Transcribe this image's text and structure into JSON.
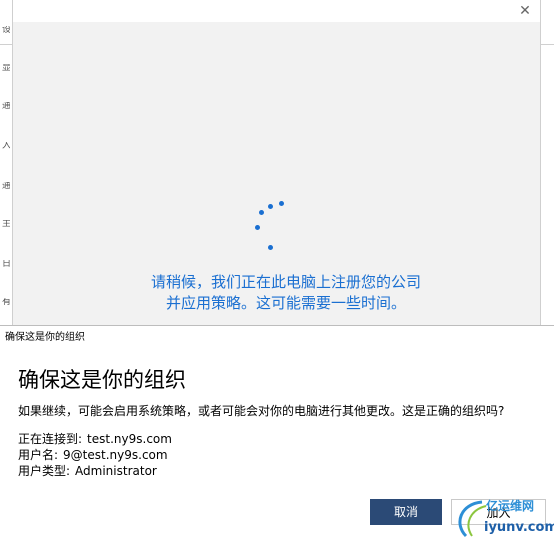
{
  "background": {
    "glyphs": [
      "设",
      "显",
      "通",
      "入",
      "通",
      "主",
      "日",
      "有"
    ]
  },
  "wait_dialog": {
    "close_glyph": "✕",
    "message": "请稍候，我们正在此电脑上注册您的公司并应用策略。这可能需要一些时间。"
  },
  "confirm_dialog": {
    "title": "确保这是你的组织",
    "heading": "确保这是你的组织",
    "description": "如果继续，可能会启用系统策略，或者可能会对你的电脑进行其他更改。这是正确的组织吗?",
    "connected_label": "正在连接到:",
    "connected_value": "test.ny9s.com",
    "username_label": "用户名:",
    "username_value": "9@test.ny9s.com",
    "usertype_label": "用户类型:",
    "usertype_value": "Administrator",
    "cancel_label": "取消",
    "join_label": "加入"
  },
  "watermark": {
    "cn": "亿运维网",
    "url": "iyunv.com"
  },
  "colors": {
    "accent_blue": "#1a6fd1",
    "cancel_bg": "#2b4a76",
    "watermark_blue": "#2d8fd6"
  }
}
